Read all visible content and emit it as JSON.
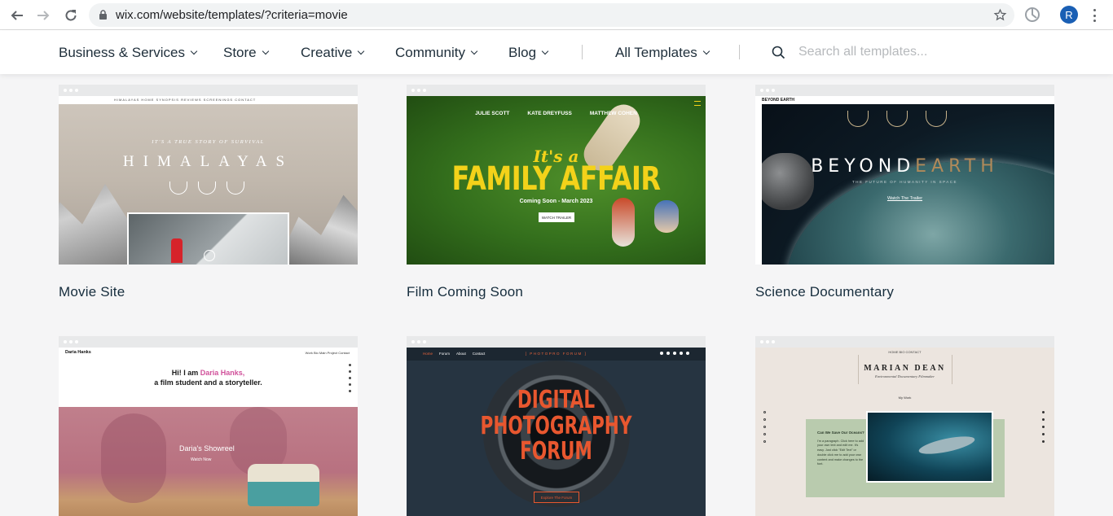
{
  "browser": {
    "url": "wix.com/website/templates/?criteria=movie",
    "profile_initial": "R"
  },
  "nav": {
    "items": [
      {
        "label": "Business & Services"
      },
      {
        "label": "Store"
      },
      {
        "label": "Creative"
      },
      {
        "label": "Community"
      },
      {
        "label": "Blog"
      },
      {
        "label": "All Templates"
      }
    ],
    "search_placeholder": "Search all templates..."
  },
  "templates": [
    {
      "name": "Movie Site",
      "preview": {
        "tagline": "IT'S A TRUE STORY OF SURVIVAL",
        "headline": "HIMALAYAS",
        "nav": "HIMALAYAS    HOME   SYNOPSIS   REVIEWS   SCREENINGS   CONTACT"
      }
    },
    {
      "name": "Film Coming Soon",
      "preview": {
        "cast": [
          "JULIE SCOTT",
          "KATE DREYFUSS",
          "MATTHEW COHEN"
        ],
        "kicker": "It's a",
        "headline": "FAMILY AFFAIR",
        "date": "Coming Soon - March 2023",
        "button": "WATCH TRAILER"
      }
    },
    {
      "name": "Science Documentary",
      "preview": {
        "brand": "BEYOND EARTH",
        "headline_a": "BEYOND",
        "headline_b": "EARTH",
        "subtitle": "THE FUTURE OF HUMANITY IN SPACE",
        "link": "Watch The Trailer"
      }
    },
    {
      "name": "",
      "preview": {
        "owner": "Daria Hanks",
        "menu": "Work   Bio   Main Project   Contact",
        "intro_a": "Hi! I am ",
        "intro_name": "Daria Hanks,",
        "intro_b": "a film student and a storyteller.",
        "reel": "Daria's Showreel",
        "watch": "Watch Now"
      }
    },
    {
      "name": "",
      "preview": {
        "links": [
          "Home",
          "Forum",
          "About",
          "Contact"
        ],
        "brand": "[ PHOTOPRO FORUM ]",
        "headline": "DIGITAL PHOTOGRAPHY FORUM",
        "button": "Explore The Forum"
      }
    },
    {
      "name": "",
      "preview": {
        "menu": "HOME   BIO   CONTACT",
        "owner": "MARIAN DEAN",
        "role": "Environmental Documentary Filmmaker",
        "section": "My Work",
        "card_title": "Can We Save Our Oceans?",
        "card_text": "I'm a paragraph. Click here to add your own text and edit me. It's easy. Just click \"Edit Text\" or double click me to add your own content and make changes to the font."
      }
    }
  ],
  "colors": {
    "page_bg": "#f5f5f6",
    "accent_yellow": "#f3d21a",
    "accent_orange": "#e8572f",
    "profile_blue": "#1a5fb4"
  }
}
